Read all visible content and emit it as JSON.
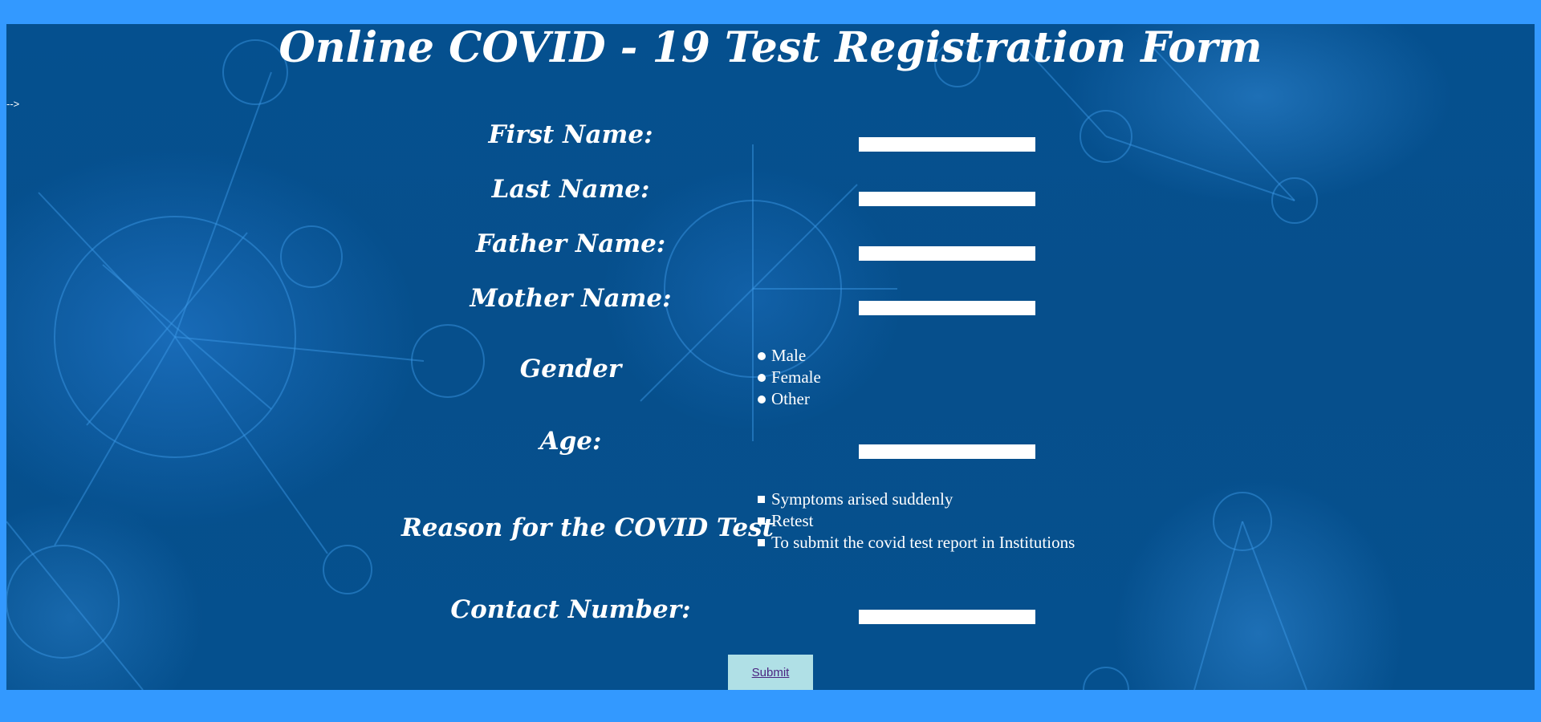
{
  "page": {
    "title": "Online COVID - 19 Test Registration Form",
    "stray_text": "-->"
  },
  "form": {
    "first_name_label": "First Name:",
    "last_name_label": "Last Name:",
    "father_name_label": "Father Name:",
    "mother_name_label": "Mother Name:",
    "gender_label": "Gender",
    "gender_options": [
      "Male",
      "Female",
      "Other"
    ],
    "age_label": "Age:",
    "reason_label": "Reason for the COVID Test",
    "reason_options": [
      "Symptoms arised suddenly",
      "Retest",
      "To submit the covid test report in Institutions"
    ],
    "contact_label": "Contact Number:",
    "first_name_value": "",
    "last_name_value": "",
    "father_name_value": "",
    "mother_name_value": "",
    "age_value": "",
    "contact_value": "",
    "submit_label": "Submit"
  },
  "colors": {
    "page_border": "#3399ff",
    "panel_background": "#05508f",
    "submit_background": "#b0e0e6",
    "submit_text": "#4b2380"
  }
}
